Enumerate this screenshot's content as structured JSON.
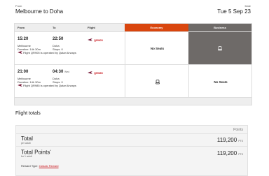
{
  "header": {
    "from_label": "From",
    "date_label": "Date",
    "route": "Melbourne to Doha",
    "date": "Tue 5 Sep 23"
  },
  "table": {
    "columns": [
      "From",
      "To",
      "Flight",
      "Economy",
      "Business"
    ],
    "rows": [
      {
        "dep_time": "15:20",
        "arr_time": "22:50",
        "arr_suffix": "",
        "from_city": "Melbourne",
        "to_city": "Doha",
        "duration": "Duration: 14h 30m",
        "stops": "Stops: 0",
        "operated": "Flight QR905 is operated by Qatar Airways",
        "flight_no": "QR905",
        "economy": "No Seats",
        "business": ""
      },
      {
        "dep_time": "21:00",
        "arr_time": "04:30",
        "arr_suffix": "Wed",
        "from_city": "Melbourne",
        "to_city": "Doha",
        "duration": "Duration: 14h 30m",
        "stops": "Stops: 0",
        "operated": "Flight QR985 is operated by Qatar Airways",
        "flight_no": "QR985",
        "economy": "",
        "business": "No Seats"
      }
    ]
  },
  "totals": {
    "title": "Flight totals",
    "points_header": "Points",
    "total_label": "Total",
    "total_sub": "per adult",
    "total_value": "119,200",
    "total_unit": "PTS",
    "total_points_label": "Total Points",
    "total_points_sup": "*",
    "total_points_sub": "for 1 adult",
    "total_points_value": "119,200",
    "total_points_unit": "PTS",
    "reward_prefix": "Reward Type:",
    "reward_link": "Classic Reward"
  }
}
